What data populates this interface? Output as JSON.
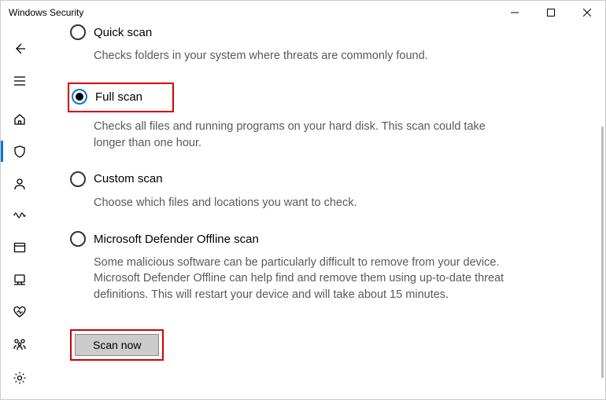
{
  "window": {
    "title": "Windows Security"
  },
  "options": {
    "quick": {
      "title": "Quick scan",
      "desc": "Checks folders in your system where threats are commonly found."
    },
    "full": {
      "title": "Full scan",
      "desc": "Checks all files and running programs on your hard disk. This scan could take longer than one hour.",
      "selected": true
    },
    "custom": {
      "title": "Custom scan",
      "desc": "Choose which files and locations you want to check."
    },
    "offline": {
      "title": "Microsoft Defender Offline scan",
      "desc": "Some malicious software can be particularly difficult to remove from your device. Microsoft Defender Offline can help find and remove them using up-to-date threat definitions. This will restart your device and will take about 15 minutes."
    }
  },
  "actions": {
    "scan_now": "Scan now"
  }
}
